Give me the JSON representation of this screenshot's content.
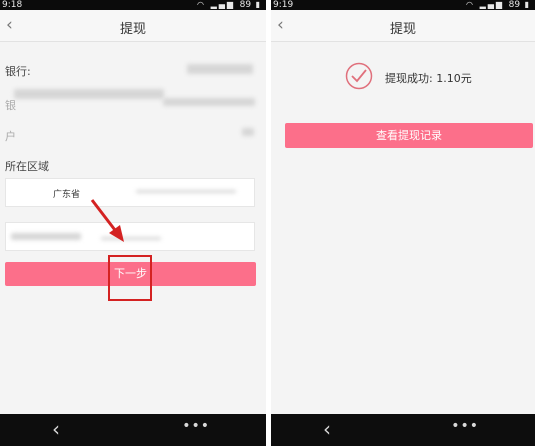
{
  "left_screen": {
    "status": {
      "time": "9:18",
      "battery": "89"
    },
    "title": "提现",
    "form": {
      "bank_label": "银行:",
      "bank_value_blurred": "",
      "card_label_partial": "银",
      "name_label_partial": "户",
      "region_label": "所在区域",
      "province_value": "广东省",
      "district_value_blurred": ""
    },
    "next_button": "下一步"
  },
  "right_screen": {
    "status": {
      "time": "9:19",
      "battery": "89"
    },
    "title": "提现",
    "success_message": "提现成功: 1.10元",
    "view_records_button": "查看提现记录"
  },
  "icons": {
    "back": "chevron-left-icon",
    "nav_back": "nav-back-icon",
    "nav_menu": "nav-more-icon",
    "success": "check-circle-icon",
    "wifi": "wifi-icon",
    "signal": "signal-icon",
    "battery": "battery-icon"
  },
  "colors": {
    "accent": "#fc6f8a",
    "annotation": "#d42222",
    "success_icon": "#e0707c"
  }
}
